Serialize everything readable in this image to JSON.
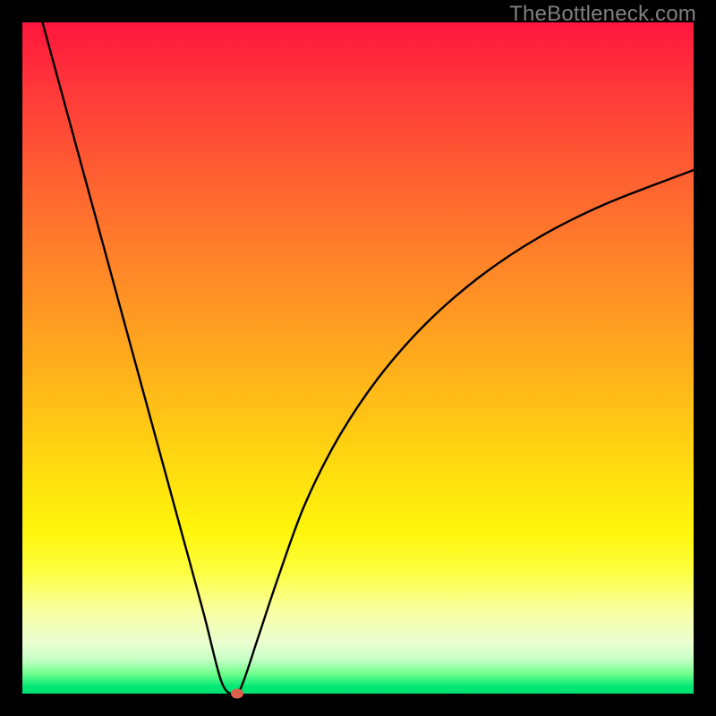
{
  "watermark": "TheBottleneck.com",
  "chart_data": {
    "type": "line",
    "title": "",
    "xlabel": "",
    "ylabel": "",
    "xlim": [
      0,
      100
    ],
    "ylim": [
      0,
      100
    ],
    "grid": false,
    "legend": false,
    "background": "vertical-gradient-red-to-green",
    "series": [
      {
        "name": "bottleneck-curve",
        "x": [
          3,
          6,
          9,
          12,
          15,
          18,
          21,
          24,
          27,
          29,
          30,
          31,
          32,
          33,
          35,
          38,
          42,
          47,
          53,
          60,
          68,
          77,
          87,
          100
        ],
        "y": [
          100,
          89,
          78,
          67,
          56,
          45,
          34,
          23,
          12,
          4,
          1,
          0,
          0,
          2,
          8,
          17,
          28,
          38,
          47,
          55,
          62,
          68,
          73,
          78
        ]
      }
    ],
    "marker": {
      "x": 32,
      "y": 0,
      "color": "#d9604a"
    }
  }
}
